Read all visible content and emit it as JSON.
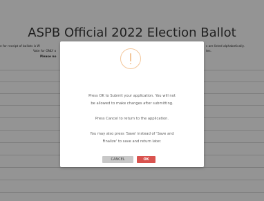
{
  "background": {
    "title": "ASPB Official 2022 Election Ballot",
    "left_lines": [
      "e for receipt of ballots is W",
      "Vote for ONLY o",
      "Please no"
    ],
    "right_lines": [
      "s are listed alphabetically.",
      "tes."
    ]
  },
  "dialog": {
    "icon": "warning-exclamation-icon",
    "message_lines": [
      "Press OK to Submit your application. You will not",
      "be allowed to make changes after submitting.",
      "Press Cancel to return to the application.",
      "You may also press 'Save' instead of 'Save and",
      "Finalize' to save and return later."
    ],
    "cancel_label": "CANCEL",
    "ok_label": "OK"
  },
  "colors": {
    "icon": "#f3c79b",
    "ok_button": "#d9534f",
    "cancel_button": "#c8c8c8",
    "overlay": "rgba(0,0,0,0.42)"
  }
}
